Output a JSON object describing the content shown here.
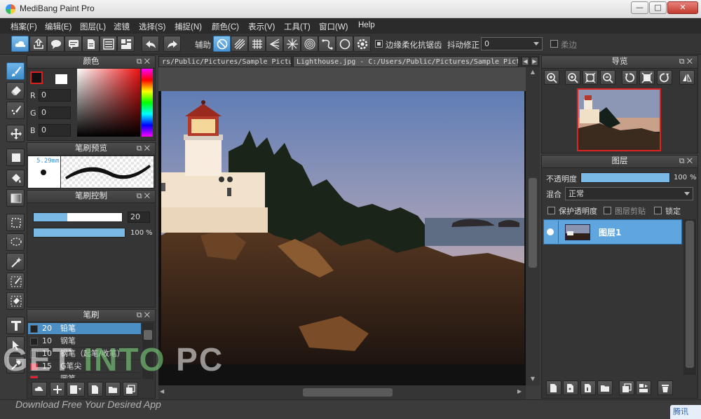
{
  "window": {
    "title": "MediBang Paint Pro",
    "min_label": "—",
    "max_label": "□",
    "close_label": "✕"
  },
  "menu": [
    "档案(F)",
    "编辑(E)",
    "图层(L)",
    "滤镜",
    "选择(S)",
    "捕捉(N)",
    "颜色(C)",
    "表示(V)",
    "工具(T)",
    "窗口(W)",
    "Help"
  ],
  "toolbar": {
    "assist_label": "辅助",
    "antialias_label": "边缘柔化抗锯齿",
    "antialias_checked": true,
    "stabilizer_label": "抖动修正",
    "stabilizer_value": "0",
    "soft_label": "柔边",
    "soft_checked": false
  },
  "color_panel": {
    "title": "颜色",
    "r_label": "R",
    "r_value": "0",
    "g_label": "G",
    "g_value": "0",
    "b_label": "B",
    "b_value": "0",
    "fg_color": "#111111",
    "bg_color": "#ffffff"
  },
  "brush_preview": {
    "title": "笔刷预览",
    "size_label": "5.29mm"
  },
  "brush_control": {
    "title": "笔刷控制",
    "size_value": "20",
    "size_level": 0.38,
    "opacity_value": "100",
    "opacity_unit": "%",
    "opacity_level": 1.0
  },
  "brush_list": {
    "title": "笔刷",
    "items": [
      {
        "size": "20",
        "name": "铅笔",
        "selected": true
      },
      {
        "size": "10",
        "name": "钢笔",
        "selected": false
      },
      {
        "size": "10",
        "name": "钢笔（起笔/收笔）",
        "selected": false
      },
      {
        "size": "15",
        "name": "G笔尖",
        "selected": false
      },
      {
        "size": "",
        "name": "圆笔",
        "selected": false
      }
    ]
  },
  "document": {
    "tab1_label": "rs/Public/Pictures/Sample Pictures",
    "tab2_label": "Lighthouse.jpg - C:/Users/Public/Pictures/Sample Pictures"
  },
  "navigator": {
    "title": "导览"
  },
  "layers": {
    "title": "图层",
    "opacity_label": "不透明度",
    "opacity_value": "100",
    "opacity_unit": "%",
    "opacity_level": 1.0,
    "blend_label": "混合",
    "blend_value": "正常",
    "protect_alpha_label": "保护透明度",
    "clipping_label": "图层剪贴",
    "lock_label": "锁定",
    "layer_name": "图层1"
  },
  "watermark": {
    "brand_a": "GET ",
    "brand_b": "INTO",
    "brand_c": " PC",
    "tagline": "Download Free Your Desired App"
  },
  "ime_label": "腾讯",
  "colors": {
    "accent": "#4c8fc4",
    "panel": "#353535",
    "menu": "#2b2b2b"
  }
}
